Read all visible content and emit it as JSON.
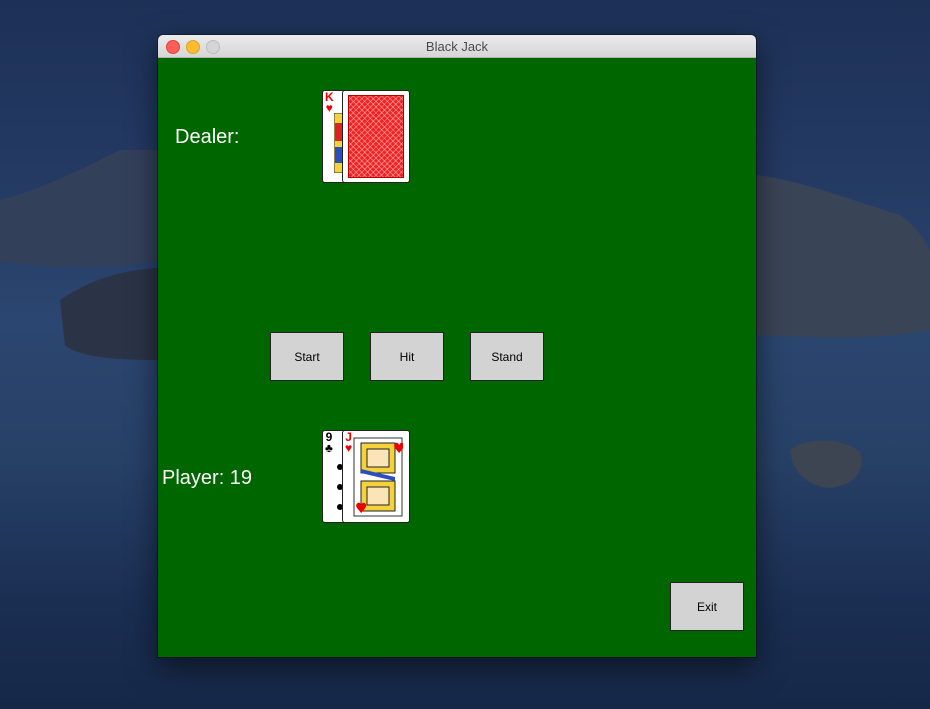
{
  "window": {
    "title": "Black Jack"
  },
  "dealer": {
    "label": "Dealer:",
    "cards": [
      {
        "rank": "K",
        "suit": "♥",
        "color": "red",
        "face_up": true
      },
      {
        "face_up": false
      }
    ]
  },
  "player": {
    "label": "Player: 19",
    "cards": [
      {
        "rank": "9",
        "suit": "♣",
        "color": "black",
        "face_up": true
      },
      {
        "rank": "J",
        "suit": "♥",
        "color": "red",
        "face_up": true
      }
    ]
  },
  "controls": {
    "start_label": "Start",
    "hit_label": "Hit",
    "stand_label": "Stand",
    "exit_label": "Exit"
  },
  "colors": {
    "table_green": "#006600",
    "card_back_red": "#e22222",
    "button_gray": "#d3d3d3"
  }
}
